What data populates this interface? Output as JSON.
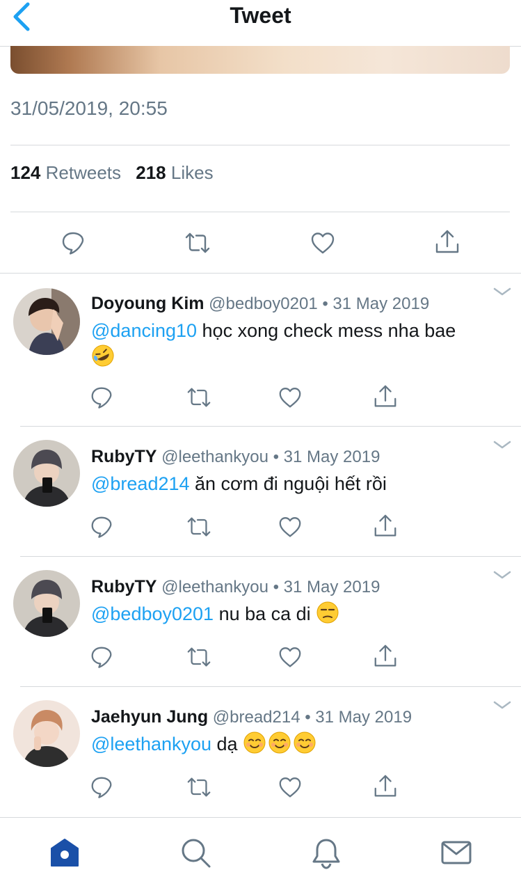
{
  "header": {
    "title": "Tweet"
  },
  "tweet": {
    "timestamp": "31/05/2019, 20:55",
    "retweets_count": "124",
    "retweets_label": "Retweets",
    "likes_count": "218",
    "likes_label": "Likes"
  },
  "replies": [
    {
      "name": "Doyoung Kim",
      "handle": "@bedboy0201",
      "date": "• 31 May 2019",
      "mention": "@dancing10",
      "text": " học xong check mess nha bae",
      "emoji": [
        "rofl-emoji"
      ]
    },
    {
      "name": "RubyTY",
      "handle": "@leethankyou",
      "date": "• 31 May 2019",
      "mention": "@bread214",
      "text": " ăn cơm đi nguội hết rồi",
      "emoji": []
    },
    {
      "name": "RubyTY",
      "handle": "@leethankyou",
      "date": "• 31 May 2019",
      "mention": "@bedboy0201",
      "text": " nu ba ca di ",
      "emoji": [
        "unamused-emoji"
      ]
    },
    {
      "name": "Jaehyun Jung",
      "handle": "@bread214",
      "date": "• 31 May 2019",
      "mention": "@leethankyou",
      "text": " dạ ",
      "emoji": [
        "smiling-emoji",
        "smiling-emoji",
        "smiling-emoji"
      ]
    }
  ],
  "tabs": [
    {
      "icon": "home-icon",
      "active": true
    },
    {
      "icon": "search-icon",
      "active": false
    },
    {
      "icon": "bell-icon",
      "active": false
    },
    {
      "icon": "mail-icon",
      "active": false
    }
  ],
  "colors": {
    "accent": "#1da1f2",
    "secondary_text": "#657786",
    "divider": "#d6d9dc",
    "home_active": "#1a50a8"
  }
}
